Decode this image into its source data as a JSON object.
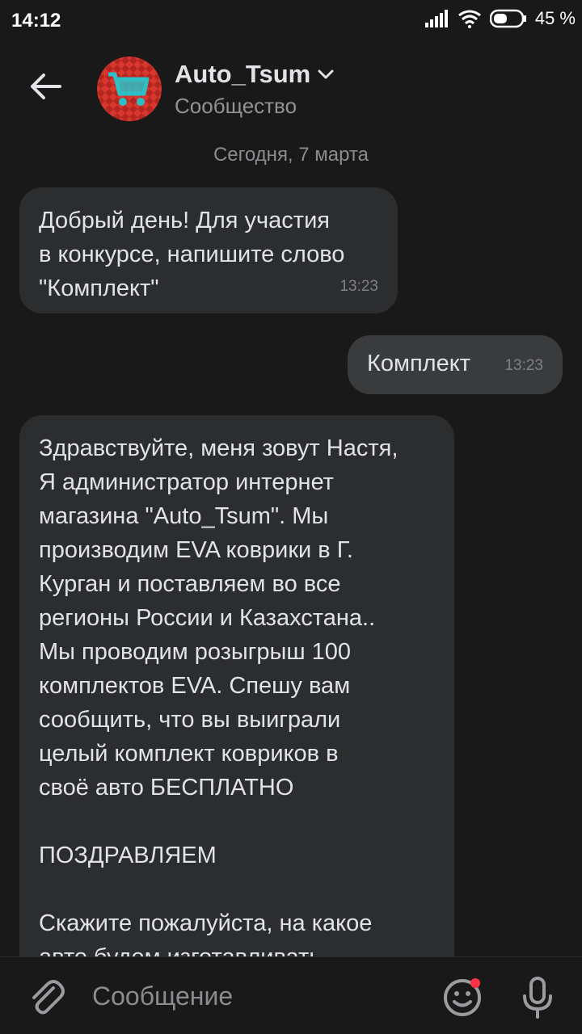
{
  "status": {
    "time": "14:12",
    "battery": "45 %"
  },
  "header": {
    "back_icon": "arrow-left-icon",
    "title": "Auto_Tsum",
    "subtitle": "Сообщество"
  },
  "date_separator": "Сегодня, 7 марта",
  "messages": [
    {
      "direction": "incoming",
      "text": "Добрый день! Для участия\nв конкурсе, напишите слово\n\"Комплект\"",
      "time": "13:23"
    },
    {
      "direction": "outgoing",
      "text": "Комплект",
      "time": "13:23"
    },
    {
      "direction": "incoming",
      "text": "Здравствуйте, меня зовут Настя,\nЯ администратор интернет\nмагазина \"Auto_Tsum\". Мы\nпроизводим EVA коврики в Г.\nКурган и поставляем во все\nрегионы России и Казахстана..\nМы проводим розыгрыш 100\nкомплектов EVA. Спешу вам\nсообщить, что вы выиграли\nцелый комплект ковриков в\nсвоё авто БЕСПЛАТНО\n\nПОЗДРАВЛЯЕМ\n\nСкажите пожалуйста, на какое\nавто будем изготавливать"
    }
  ],
  "composer": {
    "placeholder": "Сообщение",
    "attach_icon": "paperclip-icon",
    "emoji_icon": "smile-icon",
    "mic_icon": "microphone-icon"
  },
  "colors": {
    "background": "#19191a",
    "bubble_incoming": "#2c2d2e",
    "bubble_outgoing": "#3a3b3d",
    "notification_dot": "#ff3347"
  }
}
